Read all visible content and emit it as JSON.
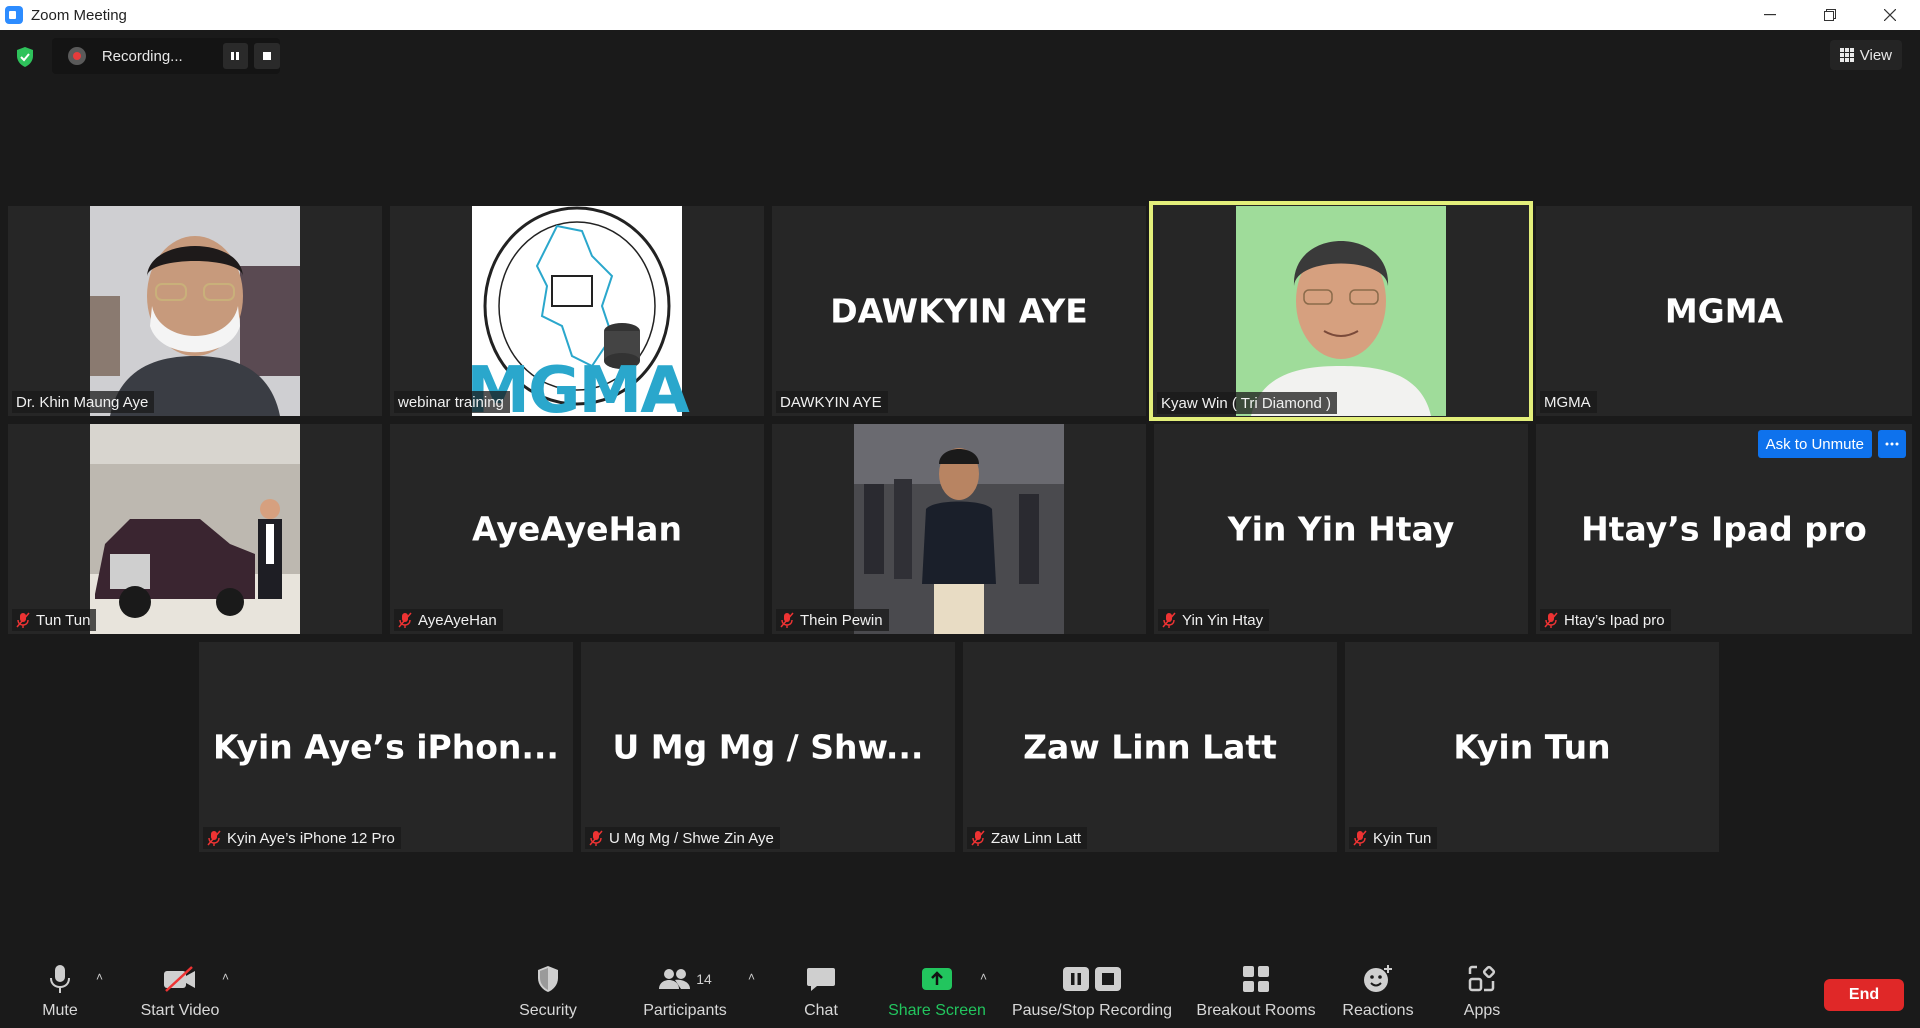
{
  "window": {
    "title": "Zoom Meeting",
    "controls": [
      "minimize",
      "restore",
      "close"
    ]
  },
  "top_bar": {
    "recording_label": "Recording...",
    "view_label": "View"
  },
  "tiles": [
    {
      "display": "",
      "name": "Dr. Khin Maung Aye",
      "type": "video-man-mask",
      "muted": false
    },
    {
      "display": "",
      "name": "webinar training",
      "type": "logo-mgma",
      "muted": false
    },
    {
      "display": "DAWKYIN AYE",
      "name": "DAWKYIN AYE",
      "type": "text",
      "muted": false
    },
    {
      "display": "",
      "name": "Kyaw Win ( Tri Diamond )",
      "type": "portrait-green",
      "muted": false,
      "active_speaker": true
    },
    {
      "display": "MGMA",
      "name": "MGMA",
      "type": "text",
      "muted": false
    },
    {
      "display": "",
      "name": "Tun Tun",
      "type": "photo-car",
      "muted": true
    },
    {
      "display": "AyeAyeHan",
      "name": "AyeAyeHan",
      "type": "text",
      "muted": true
    },
    {
      "display": "",
      "name": "Thein Pewin",
      "type": "photo-man",
      "muted": true
    },
    {
      "display": "Yin Yin Htay",
      "name": "Yin Yin Htay",
      "type": "text",
      "muted": true
    },
    {
      "display": "Htay’s Ipad pro",
      "name": "Htay’s Ipad pro",
      "type": "text",
      "muted": true,
      "ask_to_unmute": "Ask to Unmute"
    },
    {
      "display": "Kyin Aye’s iPhon...",
      "name": "Kyin Aye’s iPhone 12 Pro",
      "type": "text",
      "muted": true
    },
    {
      "display": "U Mg Mg / Shw...",
      "name": "U Mg Mg / Shwe Zin Aye",
      "type": "text",
      "muted": true
    },
    {
      "display": "Zaw Linn Latt",
      "name": "Zaw Linn Latt",
      "type": "text",
      "muted": true
    },
    {
      "display": "Kyin Tun",
      "name": "Kyin Tun",
      "type": "text",
      "muted": true
    }
  ],
  "logo_text": "MGMA",
  "toolbar": {
    "mute": "Mute",
    "start_video": "Start Video",
    "security": "Security",
    "participants": "Participants",
    "participants_count": "14",
    "chat": "Chat",
    "share_screen": "Share Screen",
    "pause_stop_recording": "Pause/Stop Recording",
    "breakout_rooms": "Breakout Rooms",
    "reactions": "Reactions",
    "apps": "Apps",
    "end": "End"
  },
  "colors": {
    "background": "#1a1a1a",
    "tile": "#262626",
    "active_speaker_border": "#e3ef7a",
    "share_green": "#22c55e",
    "ask_unmute_blue": "#0e72ed",
    "end_red": "#e02828"
  }
}
